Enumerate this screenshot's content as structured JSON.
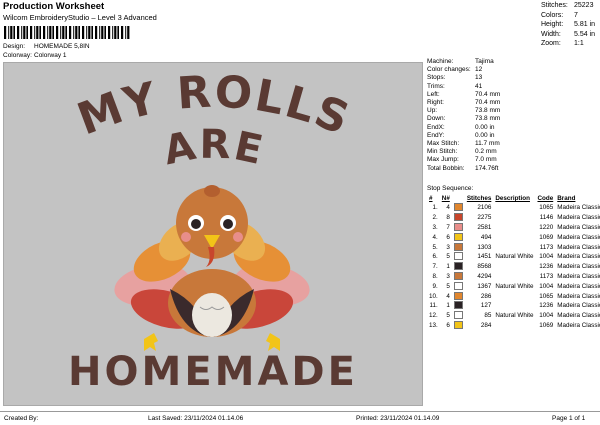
{
  "header": {
    "title": "Production Worksheet",
    "subtitle": "Wilcom EmbroideryStudio – Level 3 Advanced"
  },
  "meta": [
    {
      "label": "Design:",
      "value": "HOMEMADE 5,8IN"
    },
    {
      "label": "Colorway:",
      "value": "Colorway 1"
    }
  ],
  "summary": [
    {
      "label": "Stitches:",
      "value": "25223"
    },
    {
      "label": "Colors:",
      "value": "7"
    },
    {
      "label": "Height:",
      "value": "5.81 in"
    },
    {
      "label": "Width:",
      "value": "5.54 in"
    },
    {
      "label": "Zoom:",
      "value": "1:1"
    }
  ],
  "design": {
    "line1": "MY ROLLS",
    "line2": "ARE",
    "line3": "HOMEMADE",
    "text_color": "#5a3a33"
  },
  "machine": [
    {
      "label": "Machine:",
      "value": "Tajima"
    },
    {
      "label": "Color changes:",
      "value": "12"
    },
    {
      "label": "Stops:",
      "value": "13"
    },
    {
      "label": "Trims:",
      "value": "41"
    },
    {
      "label": "Left:",
      "value": "70.4 mm"
    },
    {
      "label": "Right:",
      "value": "70.4 mm"
    },
    {
      "label": "Up:",
      "value": "73.8 mm"
    },
    {
      "label": "Down:",
      "value": "73.8 mm"
    },
    {
      "label": "EndX:",
      "value": "0.00 in"
    },
    {
      "label": "EndY:",
      "value": "0.00 in"
    },
    {
      "label": "Max Stitch:",
      "value": "11.7 mm"
    },
    {
      "label": "Min Stitch:",
      "value": "0.2 mm"
    },
    {
      "label": "Max Jump:",
      "value": "7.0 mm"
    },
    {
      "label": "Total Bobbin:",
      "value": "174.76ft"
    }
  ],
  "stop_sequence": {
    "title": "Stop Sequence:",
    "headers": [
      "#",
      "N#",
      "",
      "Stitches",
      "Description",
      "Code",
      "Brand"
    ],
    "rows": [
      {
        "num": "1.",
        "n": "4",
        "color": "#e0862e",
        "stitches": "2106",
        "desc": "",
        "code": "1065",
        "brand": "Madeira Classic 40"
      },
      {
        "num": "2.",
        "n": "8",
        "color": "#c8462c",
        "stitches": "2275",
        "desc": "",
        "code": "1146",
        "brand": "Madeira Classic 40"
      },
      {
        "num": "3.",
        "n": "7",
        "color": "#e88e8a",
        "stitches": "2581",
        "desc": "",
        "code": "1220",
        "brand": "Madeira Classic 40"
      },
      {
        "num": "4.",
        "n": "6",
        "color": "#f2c418",
        "stitches": "494",
        "desc": "",
        "code": "1069",
        "brand": "Madeira Classic 40"
      },
      {
        "num": "5.",
        "n": "3",
        "color": "#c8783a",
        "stitches": "1303",
        "desc": "",
        "code": "1173",
        "brand": "Madeira Classic 40"
      },
      {
        "num": "6.",
        "n": "5",
        "color": "#ffffff",
        "stitches": "1451",
        "desc": "Natural White",
        "code": "1004",
        "brand": "Madeira Classic 40"
      },
      {
        "num": "7.",
        "n": "1",
        "color": "#2a2224",
        "stitches": "8568",
        "desc": "",
        "code": "1236",
        "brand": "Madeira Classic 40"
      },
      {
        "num": "8.",
        "n": "3",
        "color": "#c8783a",
        "stitches": "4294",
        "desc": "",
        "code": "1173",
        "brand": "Madeira Classic 40"
      },
      {
        "num": "9.",
        "n": "5",
        "color": "#ffffff",
        "stitches": "1367",
        "desc": "Natural White",
        "code": "1004",
        "brand": "Madeira Classic 40"
      },
      {
        "num": "10.",
        "n": "4",
        "color": "#e0862e",
        "stitches": "286",
        "desc": "",
        "code": "1065",
        "brand": "Madeira Classic 40"
      },
      {
        "num": "11.",
        "n": "1",
        "color": "#2a2224",
        "stitches": "127",
        "desc": "",
        "code": "1236",
        "brand": "Madeira Classic 40"
      },
      {
        "num": "12.",
        "n": "5",
        "color": "#ffffff",
        "stitches": "85",
        "desc": "Natural White",
        "code": "1004",
        "brand": "Madeira Classic 40"
      },
      {
        "num": "13.",
        "n": "6",
        "color": "#f2c418",
        "stitches": "284",
        "desc": "",
        "code": "1069",
        "brand": "Madeira Classic 40"
      }
    ]
  },
  "footer": {
    "created": "Created By:",
    "saved": "Last Saved: 23/11/2024 01.14.06",
    "printed": "Printed: 23/11/2024 01.14.09",
    "page": "Page 1 of 1"
  }
}
